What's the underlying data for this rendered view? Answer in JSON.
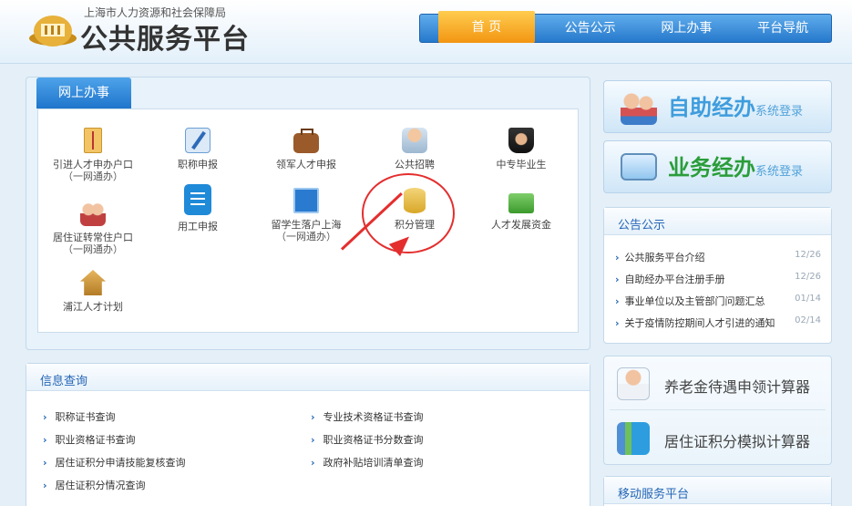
{
  "header": {
    "org_name": "上海市人力资源和社会保障局",
    "site_title": "公共服务平台",
    "nav": [
      "首 页",
      "公告公示",
      "网上办事",
      "平台导航"
    ]
  },
  "online": {
    "tab": "网上办事",
    "services": [
      {
        "label": "引进人才申办户口",
        "sub": "（一网通办）",
        "icon": "document-icon"
      },
      {
        "label": "职称申报",
        "sub": "",
        "icon": "pen-icon"
      },
      {
        "label": "领军人才申报",
        "sub": "",
        "icon": "briefcase-icon"
      },
      {
        "label": "公共招聘",
        "sub": "",
        "icon": "recruit-icon"
      },
      {
        "label": "中专毕业生",
        "sub": "",
        "icon": "graduate-icon"
      },
      {
        "label": "居住证转常住户口",
        "sub": "（一网通办）",
        "icon": "family-icon"
      },
      {
        "label": "用工申报",
        "sub": "",
        "icon": "form-icon"
      },
      {
        "label": "留学生落户上海",
        "sub": "（一网通办）",
        "icon": "book-icon"
      },
      {
        "label": "积分管理",
        "sub": "",
        "icon": "coins-icon"
      },
      {
        "label": "人才发展资金",
        "sub": "",
        "icon": "money-icon"
      },
      {
        "label": "浦江人才计划",
        "sub": "",
        "icon": "house-icon"
      }
    ]
  },
  "info": {
    "title": "信息查询",
    "queries": [
      "职称证书查询",
      "专业技术资格证书查询",
      "职业资格证书查询",
      "职业资格证书分数查询",
      "居住证积分申请技能复核查询",
      "政府补贴培训清单查询",
      "居住证积分情况查询"
    ]
  },
  "login": {
    "self_service": {
      "big": "自助经办",
      "small": "系统登录"
    },
    "business": {
      "big": "业务经办",
      "small": "系统登录"
    }
  },
  "notice": {
    "title": "公告公示",
    "items": [
      {
        "title": "公共服务平台介绍",
        "date": "12/26"
      },
      {
        "title": "自助经办平台注册手册",
        "date": "12/26"
      },
      {
        "title": "事业单位以及主管部门问题汇总",
        "date": "01/14"
      },
      {
        "title": "关于疫情防控期间人才引进的通知",
        "date": "02/14"
      }
    ]
  },
  "calculators": [
    "养老金待遇申领计算器",
    "居住证积分模拟计算器"
  ],
  "mobile": {
    "title": "移动服务平台"
  }
}
